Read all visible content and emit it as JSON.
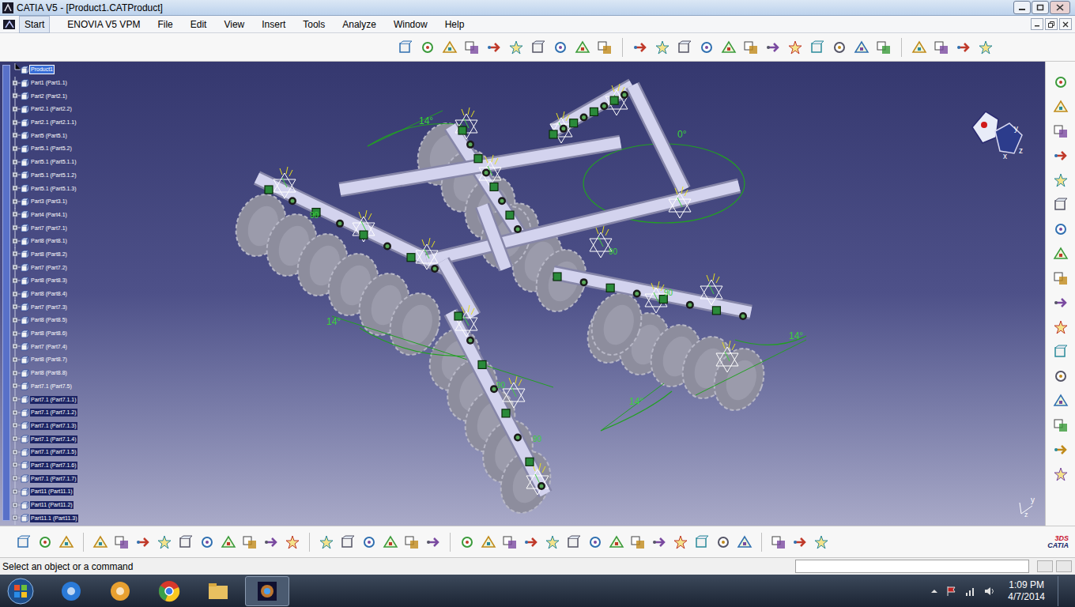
{
  "window": {
    "title": "CATIA V5 - [Product1.CATProduct]"
  },
  "menu": [
    {
      "label": "Start",
      "selected": true
    },
    {
      "label": "ENOVIA V5 VPM",
      "selected": false
    },
    {
      "label": "File",
      "selected": false
    },
    {
      "label": "Edit",
      "selected": false
    },
    {
      "label": "View",
      "selected": false
    },
    {
      "label": "Insert",
      "selected": false
    },
    {
      "label": "Tools",
      "selected": false
    },
    {
      "label": "Analyze",
      "selected": false
    },
    {
      "label": "Window",
      "selected": false
    },
    {
      "label": "Help",
      "selected": false
    }
  ],
  "tree": {
    "items": [
      {
        "label": "Product1",
        "selected": true,
        "highlighted": false
      },
      {
        "label": "Part1 (Part1.1)",
        "selected": false,
        "highlighted": false
      },
      {
        "label": "Part2 (Part2.1)",
        "selected": false,
        "highlighted": false
      },
      {
        "label": "Part2.1 (Part2.2)",
        "selected": false,
        "highlighted": false
      },
      {
        "label": "Part2.1 (Part2.1.1)",
        "selected": false,
        "highlighted": false
      },
      {
        "label": "Part5 (Part5.1)",
        "selected": false,
        "highlighted": false
      },
      {
        "label": "Part5.1 (Part5.2)",
        "selected": false,
        "highlighted": false
      },
      {
        "label": "Part5.1 (Part5.1.1)",
        "selected": false,
        "highlighted": false
      },
      {
        "label": "Part5.1 (Part5.1.2)",
        "selected": false,
        "highlighted": false
      },
      {
        "label": "Part5.1 (Part5.1.3)",
        "selected": false,
        "highlighted": false
      },
      {
        "label": "Part3 (Part3.1)",
        "selected": false,
        "highlighted": false
      },
      {
        "label": "Part4 (Part4.1)",
        "selected": false,
        "highlighted": false
      },
      {
        "label": "Part7 (Part7.1)",
        "selected": false,
        "highlighted": false
      },
      {
        "label": "Part8 (Part8.1)",
        "selected": false,
        "highlighted": false
      },
      {
        "label": "Part8 (Part8.2)",
        "selected": false,
        "highlighted": false
      },
      {
        "label": "Part7 (Part7.2)",
        "selected": false,
        "highlighted": false
      },
      {
        "label": "Part8 (Part8.3)",
        "selected": false,
        "highlighted": false
      },
      {
        "label": "Part8 (Part8.4)",
        "selected": false,
        "highlighted": false
      },
      {
        "label": "Part7 (Part7.3)",
        "selected": false,
        "highlighted": false
      },
      {
        "label": "Part8 (Part8.5)",
        "selected": false,
        "highlighted": false
      },
      {
        "label": "Part8 (Part8.6)",
        "selected": false,
        "highlighted": false
      },
      {
        "label": "Part7 (Part7.4)",
        "selected": false,
        "highlighted": false
      },
      {
        "label": "Part8 (Part8.7)",
        "selected": false,
        "highlighted": false
      },
      {
        "label": "Part8 (Part8.8)",
        "selected": false,
        "highlighted": false
      },
      {
        "label": "Part7.1 (Part7.5)",
        "selected": false,
        "highlighted": false
      },
      {
        "label": "Part7.1 (Part7.1.1)",
        "selected": false,
        "highlighted": true
      },
      {
        "label": "Part7.1 (Part7.1.2)",
        "selected": false,
        "highlighted": true
      },
      {
        "label": "Part7.1 (Part7.1.3)",
        "selected": false,
        "highlighted": true
      },
      {
        "label": "Part7.1 (Part7.1.4)",
        "selected": false,
        "highlighted": true
      },
      {
        "label": "Part7.1 (Part7.1.5)",
        "selected": false,
        "highlighted": true
      },
      {
        "label": "Part7.1 (Part7.1.6)",
        "selected": false,
        "highlighted": true
      },
      {
        "label": "Part7.1 (Part7.1.7)",
        "selected": false,
        "highlighted": true
      },
      {
        "label": "Part11 (Part11.1)",
        "selected": false,
        "highlighted": true
      },
      {
        "label": "Part11 (Part11.2)",
        "selected": false,
        "highlighted": true
      },
      {
        "label": "Part11.1 (Part11.3)",
        "selected": false,
        "highlighted": true
      }
    ]
  },
  "annotations": [
    {
      "text": "14°"
    },
    {
      "text": "14°"
    },
    {
      "text": "14°"
    },
    {
      "text": "14°"
    },
    {
      "text": "0°"
    },
    {
      "text": "90"
    },
    {
      "text": "90"
    },
    {
      "text": "90"
    },
    {
      "text": "90"
    },
    {
      "text": "90"
    }
  ],
  "compass": {
    "axes": [
      "y",
      "x",
      "z"
    ]
  },
  "axis_triad": [
    "y",
    "z"
  ],
  "logo": {
    "mark": "3DS",
    "name": "CATIA"
  },
  "status_bar": {
    "message": "Select an object or a command",
    "input": ""
  },
  "taskbar": {
    "time": "1:09 PM",
    "date": "4/7/2014"
  }
}
